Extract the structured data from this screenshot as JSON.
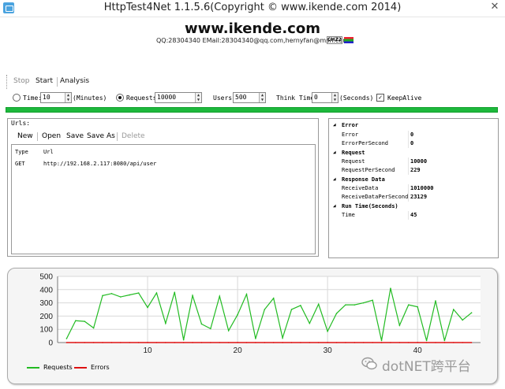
{
  "window": {
    "title": "HttpTest4Net 1.1.5.6(Copyright © www.ikende.com  2014)",
    "close_glyph": "✕"
  },
  "header": {
    "title": "www.ikende.com",
    "contact": "QQ:28304340 EMail:28304340@qq.com,hernyfan@msn.com",
    "flag_code": "CHZ2"
  },
  "toolbar": {
    "stop": "Stop",
    "start": "Start",
    "analysis": "Analysis"
  },
  "options": {
    "time_label": "Time:",
    "time_value": "10",
    "time_unit": "(Minutes)",
    "requests_label": "Requests:",
    "requests_value": "10000",
    "users_label": "Users:",
    "users_value": "500",
    "think_label": "Think Time:",
    "think_value": "0",
    "think_unit": "(Seconds)",
    "keepalive_label": "KeepAlive",
    "keepalive_checked": true,
    "mode": "requests"
  },
  "progress": {
    "value": 1.0,
    "color": "#1db83c"
  },
  "urls": {
    "title": "Urls:",
    "toolbar": {
      "new": "New",
      "open": "Open",
      "save": "Save",
      "save_as": "Save As",
      "delete": "Delete"
    },
    "columns": [
      "Type",
      "Url"
    ],
    "rows": [
      {
        "type": "GET",
        "url": "http://192.168.2.117:8080/api/user"
      }
    ]
  },
  "stats": {
    "error_cat": "Error",
    "error": {
      "label": "Error",
      "value": "0"
    },
    "eps": {
      "label": "ErrorPerSecond",
      "value": "0"
    },
    "request_cat": "Request",
    "request": {
      "label": "Request",
      "value": "10000"
    },
    "rps": {
      "label": "RequestPerSecond",
      "value": "229"
    },
    "response_cat": "Response Data",
    "recv": {
      "label": "ReceiveData",
      "value": "1010000"
    },
    "rdps": {
      "label": "ReceiveDataPerSecond",
      "value": "23129"
    },
    "runtime_cat": "Run Time(Seconds)",
    "time": {
      "label": "Time",
      "value": "45"
    }
  },
  "chart_data": {
    "type": "line",
    "x": [
      1,
      2,
      3,
      4,
      5,
      6,
      7,
      8,
      9,
      10,
      11,
      12,
      13,
      14,
      15,
      16,
      17,
      18,
      19,
      20,
      21,
      22,
      23,
      24,
      25,
      26,
      27,
      28,
      29,
      30,
      31,
      32,
      33,
      34,
      35,
      36,
      37,
      38,
      39,
      40,
      41,
      42,
      43,
      44,
      45,
      46
    ],
    "series": [
      {
        "name": "Requests",
        "color": "#22bb22",
        "values": [
          30,
          165,
          160,
          110,
          355,
          370,
          345,
          360,
          375,
          265,
          375,
          145,
          380,
          20,
          355,
          140,
          105,
          350,
          90,
          210,
          365,
          30,
          250,
          335,
          35,
          250,
          280,
          145,
          290,
          85,
          220,
          285,
          285,
          300,
          320,
          15,
          410,
          130,
          285,
          270,
          15,
          315,
          15,
          250,
          170,
          225
        ]
      },
      {
        "name": "Errors",
        "color": "#dd1111",
        "values": [
          0,
          0,
          0,
          0,
          0,
          0,
          0,
          0,
          0,
          0,
          0,
          0,
          0,
          0,
          0,
          0,
          0,
          0,
          0,
          0,
          0,
          0,
          0,
          0,
          0,
          0,
          0,
          0,
          0,
          0,
          0,
          0,
          0,
          0,
          0,
          0,
          0,
          0,
          0,
          0,
          0,
          0,
          0,
          0,
          0,
          0
        ]
      }
    ],
    "ylim": [
      0,
      500
    ],
    "xlim": [
      0,
      47
    ],
    "yticks": [
      0,
      100,
      200,
      300,
      400,
      500
    ],
    "xticks": [
      10,
      20,
      30,
      40
    ],
    "grid": true,
    "legend": "bottom-left"
  },
  "watermark": {
    "text": "dotNET跨平台"
  }
}
